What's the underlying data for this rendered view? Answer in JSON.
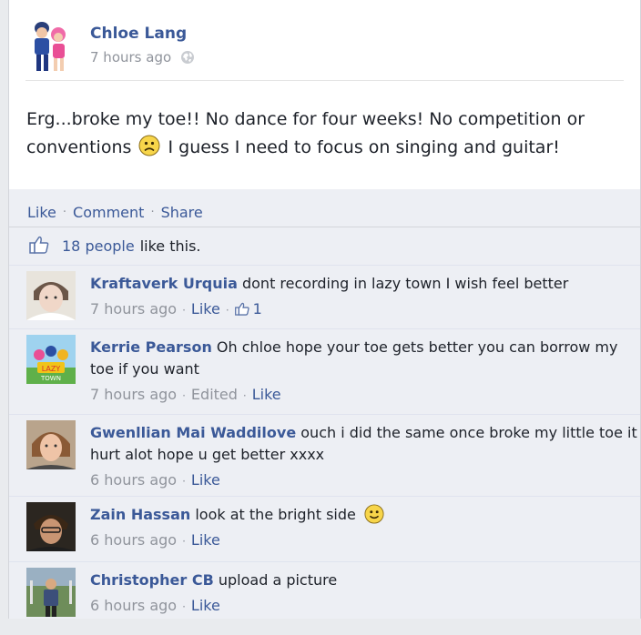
{
  "post": {
    "author": "Chloe Lang",
    "time": "7 hours ago",
    "text_part1": "Erg...broke my toe!! No dance for four weeks! No competition or conventions",
    "text_part2": "I guess I need to focus on singing and guitar!"
  },
  "actions": {
    "like": "Like",
    "comment": "Comment",
    "share": "Share"
  },
  "likes": {
    "count_text": "18 people",
    "suffix": "like this."
  },
  "comments": [
    {
      "author": "Kraftaverk Urquia",
      "text": "dont recording in lazy town I wish feel better",
      "time": "7 hours ago",
      "like": "Like",
      "like_count": "1"
    },
    {
      "author": "Kerrie Pearson",
      "text": "Oh chloe hope your toe gets better you can borrow my toe if you want",
      "time": "7 hours ago",
      "edited": "Edited",
      "like": "Like"
    },
    {
      "author": "Gwenllian Mai Waddilove",
      "text": "ouch i did the same once broke my little toe it hurt alot hope u get better xxxx",
      "time": "6 hours ago",
      "like": "Like"
    },
    {
      "author": "Zain Hassan",
      "text": "look at the bright side",
      "time": "6 hours ago",
      "like": "Like"
    },
    {
      "author": "Christopher CB",
      "text": "upload a picture",
      "time": "6 hours ago",
      "like": "Like"
    }
  ],
  "icons": {
    "globe": "globe-icon",
    "sad_emoticon": "sad-face-icon",
    "thumb": "thumbs-up-icon",
    "smile_emoticon": "smile-face-icon"
  },
  "colors": {
    "link": "#3b5998",
    "meta": "#90949c",
    "ufi_bg": "#edeff4"
  }
}
